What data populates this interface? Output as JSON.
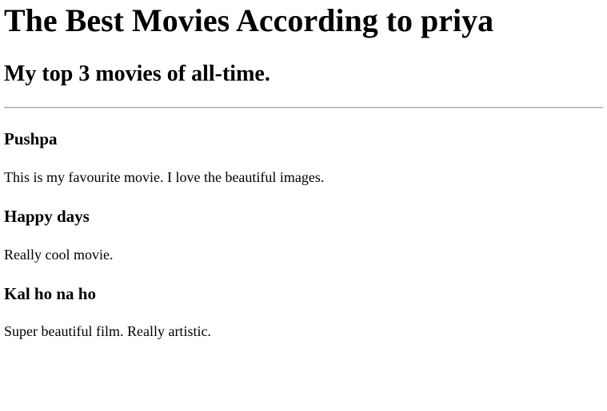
{
  "page": {
    "title": "The Best Movies According to priya",
    "subtitle": "My top 3 movies of all-time."
  },
  "movies": [
    {
      "title": "Pushpa",
      "description": "This is my favourite movie. I love the beautiful images."
    },
    {
      "title": "Happy days",
      "description": "Really cool movie."
    },
    {
      "title": "Kal ho na ho",
      "description": "Super beautiful film. Really artistic."
    }
  ]
}
